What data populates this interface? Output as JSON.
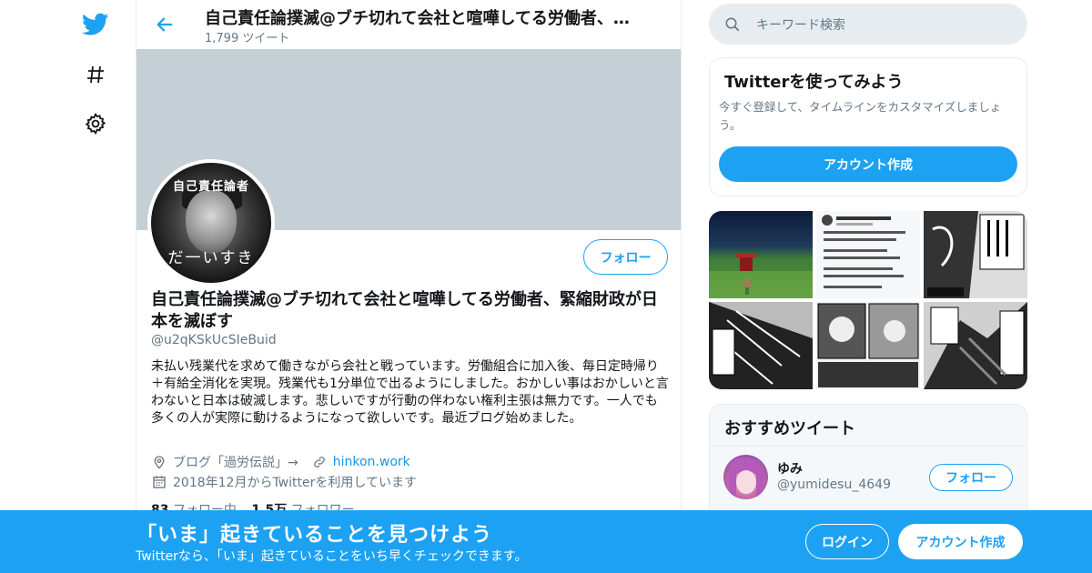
{
  "colors": {
    "brand": "#1da1f2",
    "banner": "#c4cfd6",
    "secondary_text": "#657786",
    "link": "#1b95e0"
  },
  "nav": {
    "icons": [
      "twitter-logo-icon",
      "hashtag-icon",
      "gear-icon"
    ]
  },
  "header": {
    "title": "自己責任論撲滅@ブチ切れて会社と喧嘩してる労働者、緊縮財政が日本を滅ぼす",
    "tweet_count": "1,799 ツイート"
  },
  "profile": {
    "avatar_text_top": "自己責任論者",
    "avatar_text_bottom": "だ一いすき",
    "follow_label": "フォロー",
    "display_name": "自己責任論撲滅@ブチ切れて会社と喧嘩してる労働者、緊縮財政が日本を滅ぼす",
    "handle": "@u2qKSkUcSIeBuid",
    "bio": "未払い残業代を求めて働きながら会社と戦っています。労働組合に加入後、毎日定時帰り＋有給全消化を実現。残業代も1分単位で出るようにしました。おかしい事はおかしいと言わないと日本は破滅します。悲しいですが行動の伴わない権利主張は無力です。一人でも多くの人が実際に動けるようになって欲しいです。最近ブログ始めました。",
    "location": "ブログ「過労伝説」→",
    "url": "hinkon.work",
    "joined": "2018年12月からTwitterを利用しています",
    "following_count": "83",
    "following_label": "フォロー中",
    "followers_count": "1.5万",
    "followers_label": "フォロワー"
  },
  "search": {
    "placeholder": "キーワード検索"
  },
  "signup_card": {
    "title": "Twitterを使ってみよう",
    "description": "今すぐ登録して、タイムラインをカスタマイズしましょう。",
    "button": "アカウント作成"
  },
  "media": {
    "tiles": [
      "anime-scene",
      "tweet-screenshot",
      "manga-panel",
      "manga-panel",
      "manga-panel",
      "manga-panel"
    ]
  },
  "recommend": {
    "title": "おすすめツイート",
    "user_name": "ゆみ",
    "user_handle": "@yumidesu_4649",
    "follow_label": "フォロー"
  },
  "bottom_bar": {
    "title": "「いま」起きていることを見つけよう",
    "subtitle": "Twitterなら、「いま」起きていることをいち早くチェックできます。",
    "login": "ログイン",
    "signup": "アカウント作成"
  }
}
